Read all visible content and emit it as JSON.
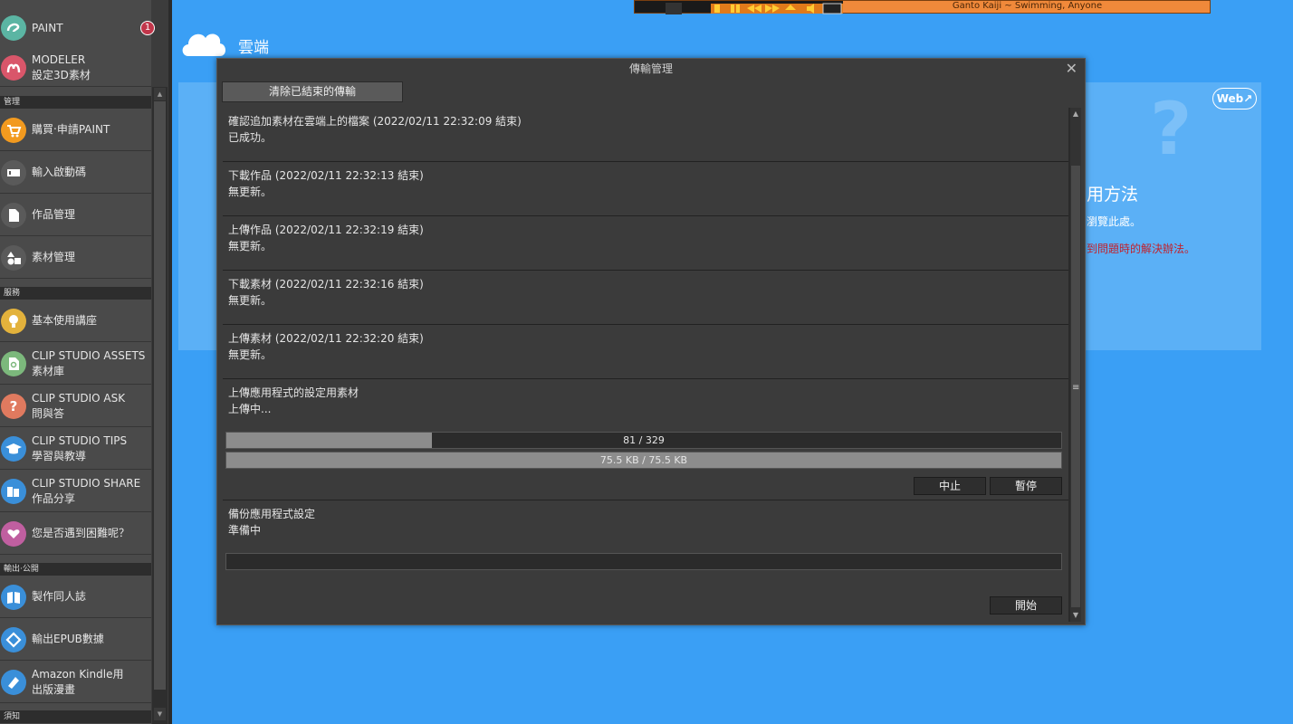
{
  "sidebar": {
    "sections": {
      "manage": "管理",
      "service": "服務",
      "export": "輸出‧公開",
      "notice": "須知"
    },
    "items": [
      {
        "lines": [
          "PAINT"
        ],
        "icon": "paint-icon",
        "color": "#5bb5a3",
        "badge": "1"
      },
      {
        "lines": [
          "MODELER",
          "設定3D素材"
        ],
        "icon": "modeler-icon",
        "color": "#d9566a"
      },
      {
        "lines": [
          "購買‧申請PAINT"
        ],
        "icon": "cart-icon",
        "color": "#f29a1f"
      },
      {
        "lines": [
          "輸入啟動碼"
        ],
        "icon": "ticket-icon",
        "color": "#5a5a5a"
      },
      {
        "lines": [
          "作品管理"
        ],
        "icon": "document-icon",
        "color": "#5a5a5a"
      },
      {
        "lines": [
          "素材管理"
        ],
        "icon": "shapes-icon",
        "color": "#5a5a5a"
      },
      {
        "lines": [
          "基本使用講座"
        ],
        "icon": "lightbulb-icon",
        "color": "#e3b23c"
      },
      {
        "lines": [
          "CLIP STUDIO ASSETS",
          "素材庫"
        ],
        "icon": "assets-icon",
        "color": "#7cb87c"
      },
      {
        "lines": [
          "CLIP STUDIO ASK",
          "問與答"
        ],
        "icon": "question-icon",
        "color": "#e07a5f"
      },
      {
        "lines": [
          "CLIP STUDIO TIPS",
          "學習與教導"
        ],
        "icon": "graduation-icon",
        "color": "#3a8fd9"
      },
      {
        "lines": [
          "CLIP STUDIO SHARE",
          "作品分享"
        ],
        "icon": "share-icon",
        "color": "#3a8fd9"
      },
      {
        "lines": [
          "您是否遇到困難呢？"
        ],
        "icon": "heart-hand-icon",
        "color": "#c05fa0"
      },
      {
        "lines": [
          "製作同人誌"
        ],
        "icon": "book-icon",
        "color": "#3a8fd9"
      },
      {
        "lines": [
          "輸出EPUB數據"
        ],
        "icon": "epub-icon",
        "color": "#3a8fd9"
      },
      {
        "lines": [
          "Amazon Kindle用",
          "出版漫畫"
        ],
        "icon": "kindle-icon",
        "color": "#3a8fd9"
      }
    ]
  },
  "media": {
    "song": "Ganto Kaiji ~ Swimming, Anyone"
  },
  "main": {
    "title": "雲端",
    "web_button": "Web↗",
    "usage_heading": "用方法",
    "browse_text": "瀏覽此處。",
    "trouble_text": "到問題時的解決辦法。"
  },
  "dialog": {
    "title": "傳輸管理",
    "close": "✕",
    "clear_button": "清除已結束的傳輸",
    "entries": [
      {
        "title": "確認追加素材在雲端上的檔案 (2022/02/11 22:32:09 結束)",
        "status": "已成功。"
      },
      {
        "title": "下載作品 (2022/02/11 22:32:13 結束)",
        "status": "無更新。"
      },
      {
        "title": "上傳作品 (2022/02/11 22:32:19 結束)",
        "status": "無更新。"
      },
      {
        "title": "下載素材 (2022/02/11 22:32:16 結束)",
        "status": "無更新。"
      },
      {
        "title": "上傳素材 (2022/02/11 22:32:20 結束)",
        "status": "無更新。"
      }
    ],
    "uploading": {
      "title": "上傳應用程式的設定用素材",
      "status": "上傳中...",
      "count_label": "81 / 329",
      "count_progress": 0.246,
      "size_label": "75.5 KB / 75.5 KB",
      "size_progress": 1.0,
      "stop_button": "中止",
      "pause_button": "暫停"
    },
    "backup": {
      "title": "備份應用程式設定",
      "status": "準備中",
      "progress": 0,
      "start_button": "開始"
    }
  }
}
